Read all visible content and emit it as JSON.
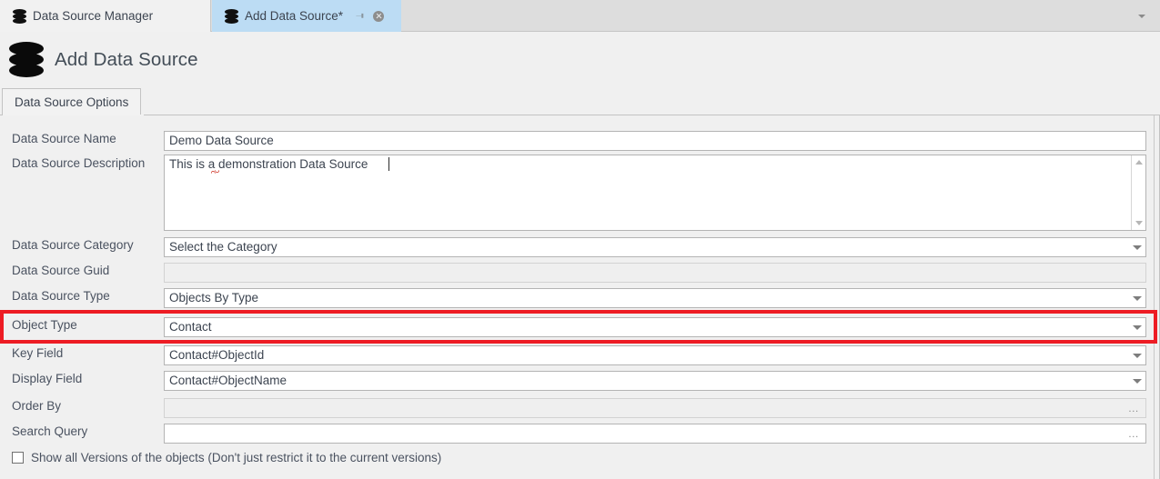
{
  "window": {
    "tabs": [
      {
        "label": "Data Source Manager",
        "icon": "database-icon",
        "active": false
      },
      {
        "label": "Add Data Source*",
        "icon": "database-icon",
        "active": true,
        "pin": "pin-icon",
        "close": "close-icon"
      }
    ],
    "overflow_icon": "chevron-down-icon"
  },
  "header": {
    "icon": "database-icon",
    "title": "Add Data Source"
  },
  "content_tabs": [
    {
      "label": "Data Source Options",
      "active": true
    }
  ],
  "form": {
    "rows": [
      {
        "label": "Data Source Name",
        "value": "Demo Data Source",
        "control": "text",
        "enabled": true
      },
      {
        "label": "Data Source Description",
        "value": "This is a demonstration Data Source",
        "control": "textarea",
        "enabled": true
      },
      {
        "label": "Data Source Category",
        "value": "Select the Category",
        "control": "dropdown",
        "enabled": true
      },
      {
        "label": "Data Source Guid",
        "value": "",
        "control": "text",
        "enabled": false
      },
      {
        "label": "Data Source Type",
        "value": "Objects By Type",
        "control": "dropdown",
        "enabled": true
      },
      {
        "label": "Object Type",
        "value": "Contact",
        "control": "dropdown",
        "enabled": true,
        "highlighted": true
      },
      {
        "label": "Key Field",
        "value": "Contact#ObjectId",
        "control": "dropdown",
        "enabled": true
      },
      {
        "label": "Display Field",
        "value": "Contact#ObjectName",
        "control": "dropdown",
        "enabled": true
      },
      {
        "label": "Order By",
        "value": "",
        "control": "ellipsis",
        "enabled": false
      },
      {
        "label": "Search Query",
        "value": "",
        "control": "ellipsis",
        "enabled": true
      }
    ],
    "checkbox": {
      "label": "Show all Versions of the objects (Don't just restrict it to the current versions)",
      "checked": false
    }
  },
  "colors": {
    "highlight": "#ed1c24",
    "active_tab": "#bcdcf4",
    "tabbar_bg": "#dddddd",
    "panel_bg": "#f0f0f0",
    "text": "#3c4450",
    "disabled_bg": "#efefef"
  }
}
